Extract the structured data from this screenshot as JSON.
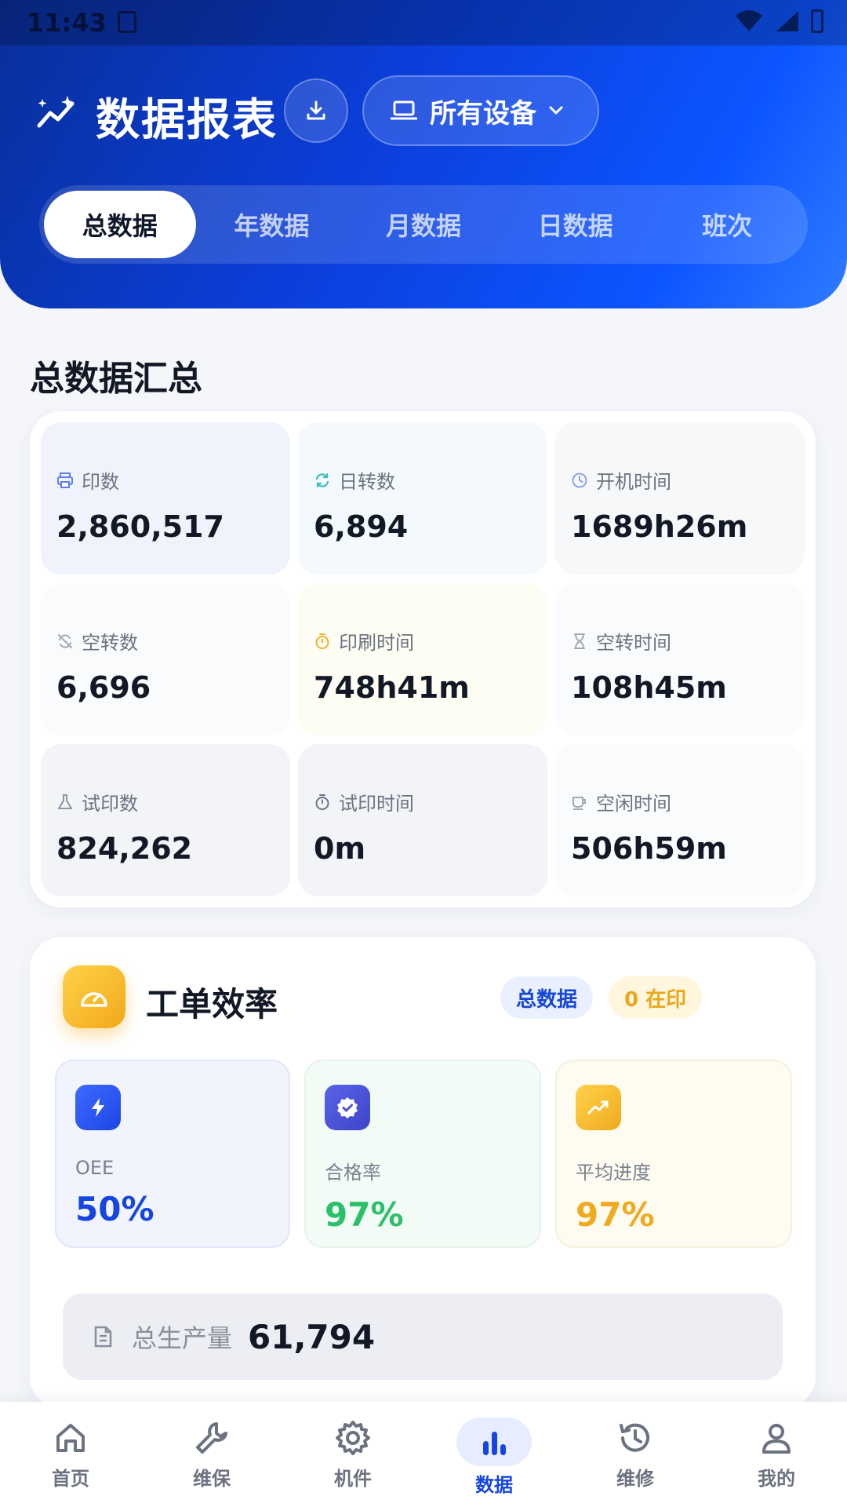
{
  "status_bar": {
    "time": "11:43"
  },
  "header": {
    "title": "数据报表",
    "device_select": "所有设备",
    "tabs": [
      "总数据",
      "年数据",
      "月数据",
      "日数据",
      "班次"
    ],
    "active_tab": 0
  },
  "summary": {
    "title": "总数据汇总",
    "cells": [
      {
        "label": "印数",
        "value": "2,860,517",
        "icon": "printer-icon"
      },
      {
        "label": "日转数",
        "value": "6,894",
        "icon": "refresh-icon"
      },
      {
        "label": "开机时间",
        "value": "1689h26m",
        "icon": "clock-icon"
      },
      {
        "label": "空转数",
        "value": "6,696",
        "icon": "refresh-off-icon"
      },
      {
        "label": "印刷时间",
        "value": "748h41m",
        "icon": "timer-icon"
      },
      {
        "label": "空转时间",
        "value": "108h45m",
        "icon": "hourglass-icon"
      },
      {
        "label": "试印数",
        "value": "824,262",
        "icon": "flask-icon"
      },
      {
        "label": "试印时间",
        "value": "0m",
        "icon": "stopwatch-icon"
      },
      {
        "label": "空闲时间",
        "value": "506h59m",
        "icon": "coffee-icon"
      }
    ]
  },
  "efficiency": {
    "title": "工单效率",
    "badge_scope": "总数据",
    "badge_printing": "0 在印",
    "metrics": [
      {
        "label": "OEE",
        "value": "50%",
        "icon": "lightning-icon"
      },
      {
        "label": "合格率",
        "value": "97%",
        "icon": "verified-badge-icon"
      },
      {
        "label": "平均进度",
        "value": "97%",
        "icon": "trending-up-icon"
      }
    ],
    "total_production_label": "总生产量",
    "total_production_value": "61,794"
  },
  "bottom_nav": {
    "items": [
      "首页",
      "维保",
      "机件",
      "数据",
      "维修",
      "我的"
    ],
    "active": 3
  },
  "colors": {
    "primary": "#0b3fdc",
    "oee": "#1646e0",
    "pass_rate": "#2bc06a",
    "progress": "#efaa1f"
  }
}
